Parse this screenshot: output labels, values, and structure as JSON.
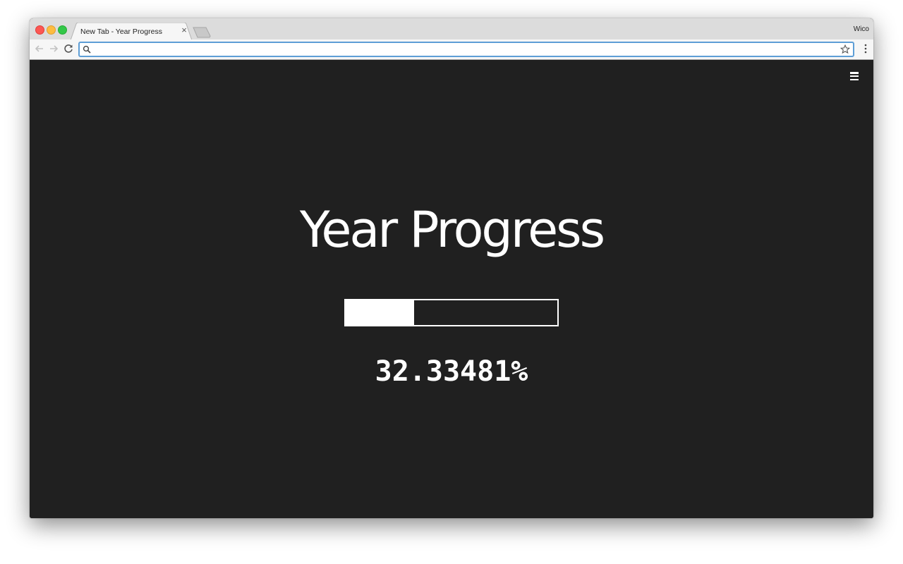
{
  "browser": {
    "tab_title": "New Tab - Year Progress",
    "tab_close": "×",
    "profile_name": "Wico",
    "omnibox": {
      "value": "",
      "placeholder": ""
    }
  },
  "page": {
    "title": "Year Progress",
    "progress_fraction": 0.3233481,
    "progress_text": "32.33481%"
  },
  "colors": {
    "background": "#202020",
    "foreground": "#ffffff",
    "omnibox_focus": "#5e9ed6"
  },
  "icons": [
    "back-icon",
    "forward-icon",
    "reload-icon",
    "search-icon",
    "star-icon",
    "kebab-menu-icon",
    "hamburger-menu-icon"
  ]
}
